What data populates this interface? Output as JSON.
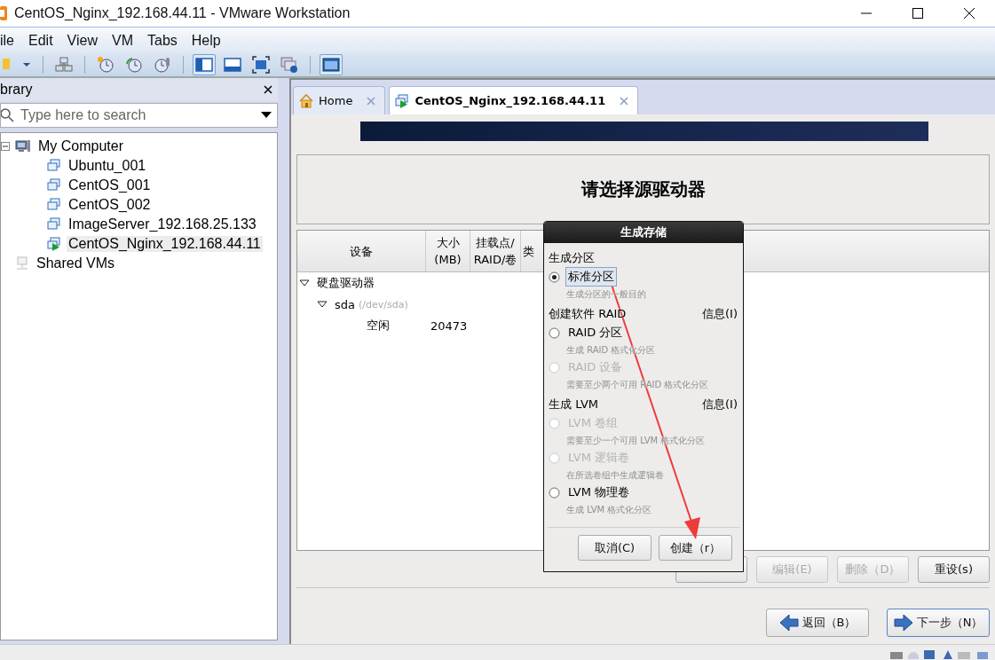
{
  "window": {
    "title": "CentOS_Nginx_192.168.44.11 - VMware Workstation"
  },
  "menu": [
    "ile",
    "Edit",
    "View",
    "VM",
    "Tabs",
    "Help"
  ],
  "toolbar": [
    {
      "kind": "folder",
      "selected": false
    },
    {
      "kind": "dropdown",
      "selected": false
    },
    {
      "kind": "separator"
    },
    {
      "kind": "network",
      "selected": false
    },
    {
      "kind": "separator"
    },
    {
      "kind": "snapshot",
      "selected": false
    },
    {
      "kind": "revert",
      "selected": false
    },
    {
      "kind": "manage",
      "selected": false
    },
    {
      "kind": "separator"
    },
    {
      "kind": "library",
      "selected": true
    },
    {
      "kind": "thumbnail",
      "selected": false
    },
    {
      "kind": "fullscreen",
      "selected": false
    },
    {
      "kind": "unity",
      "selected": false
    },
    {
      "kind": "separator"
    },
    {
      "kind": "console",
      "selected": true
    }
  ],
  "library": {
    "title": "brary",
    "search": {
      "placeholder": "Type here to search"
    },
    "tree": [
      {
        "label": "My Computer",
        "kind": "computer",
        "expanded": true,
        "selected": false,
        "children": [
          {
            "label": "Ubuntu_001",
            "kind": "vm",
            "running": false,
            "selected": false
          },
          {
            "label": "CentOS_001",
            "kind": "vm",
            "running": false,
            "selected": false
          },
          {
            "label": "CentOS_002",
            "kind": "vm",
            "running": false,
            "selected": false
          },
          {
            "label": "ImageServer_192.168.25.133",
            "kind": "vm",
            "running": false,
            "selected": false
          },
          {
            "label": "CentOS_Nginx_192.168.44.11",
            "kind": "vm",
            "running": true,
            "selected": true
          }
        ]
      },
      {
        "label": "Shared VMs",
        "kind": "shared",
        "selected": false
      }
    ]
  },
  "tabs": [
    {
      "label": "Home",
      "kind": "home",
      "selected": false
    },
    {
      "label": "CentOS_Nginx_192.168.44.11",
      "kind": "vm",
      "selected": true
    }
  ],
  "installer": {
    "heading": "请选择源驱动器",
    "columns": [
      {
        "lines": [
          "设备"
        ]
      },
      {
        "lines": [
          "大小",
          "(MB)"
        ]
      },
      {
        "lines": [
          "挂载点/",
          "RAID/卷"
        ]
      },
      {
        "lines": [
          "类"
        ]
      }
    ],
    "rows": [
      {
        "label": "硬盘驱动器",
        "expanded": true,
        "children": [
          {
            "label": "sda",
            "detail": "(/dev/sda)",
            "expanded": true,
            "children": [
              {
                "label": "空闲",
                "size": "20473"
              }
            ]
          }
        ]
      }
    ],
    "buttons": [
      {
        "disabled": false
      },
      {
        "label": "编辑(E)",
        "disabled": true
      },
      {
        "label": "删除（D）",
        "disabled": true
      },
      {
        "label": "重设(s)",
        "disabled": false
      }
    ],
    "nav": [
      {
        "label": "返回（B）",
        "kind": "back",
        "focused": false
      },
      {
        "label": "下一步（N）",
        "kind": "next",
        "focused": true
      }
    ]
  },
  "dialog": {
    "title": "生成存储",
    "sections": [
      {
        "heading": "生成分区",
        "options": [
          {
            "label": "标准分区",
            "hint": "生成分区的一般目的",
            "selected": true,
            "disabled": false
          }
        ]
      },
      {
        "heading": "创建软件 RAID",
        "info": "信息(I)",
        "options": [
          {
            "label": "RAID 分区",
            "hint": "生成 RAID 格式化分区",
            "selected": false,
            "disabled": false
          },
          {
            "label": "RAID 设备",
            "hint": "需要至少两个可用 RAID 格式化分区",
            "selected": false,
            "disabled": true
          }
        ]
      },
      {
        "heading": "生成 LVM",
        "info": "信息(I)",
        "options": [
          {
            "label": "LVM 卷组",
            "hint": "需要至少一个可用 LVM 格式化分区",
            "selected": false,
            "disabled": true
          },
          {
            "label": "LVM 逻辑卷",
            "hint": "在所选卷组中生成逻辑卷",
            "selected": false,
            "disabled": true
          },
          {
            "label": "LVM 物理卷",
            "hint": "生成 LVM 格式化分区",
            "selected": false,
            "disabled": false
          }
        ]
      }
    ],
    "buttons": [
      "取消(C)",
      "创建（r）"
    ]
  }
}
